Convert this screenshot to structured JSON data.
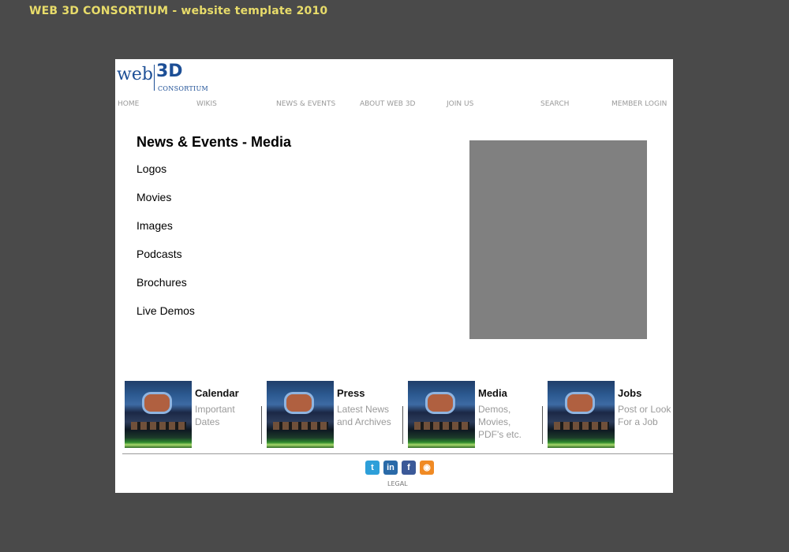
{
  "page_header": "WEB 3D CONSORTIUM - website template 2010",
  "logo": {
    "web": "web",
    "three_d": "3D",
    "consortium": "CONSORTIUM"
  },
  "nav": [
    {
      "label": "HOME"
    },
    {
      "label": "WIKIS"
    },
    {
      "label": "NEWS & EVENTS"
    },
    {
      "label": "ABOUT WEB 3D"
    },
    {
      "label": "JOIN US"
    },
    {
      "label": "SEARCH"
    },
    {
      "label": "MEMBER LOGIN"
    }
  ],
  "main": {
    "title": "News & Events - Media",
    "media_links": [
      "Logos",
      "Movies",
      "Images",
      "Podcasts",
      "Brochures",
      "Live Demos"
    ]
  },
  "features": [
    {
      "title": "Calendar",
      "desc": "Important Dates"
    },
    {
      "title": "Press",
      "desc": "Latest News and Archives"
    },
    {
      "title": "Media",
      "desc": "Demos, Movies, PDF's etc."
    },
    {
      "title": "Jobs",
      "desc": "Post or Look For a Job"
    }
  ],
  "social_icons": [
    {
      "name": "twitter-icon",
      "glyph": "t",
      "color": "#2d9fd9"
    },
    {
      "name": "linkedin-icon",
      "glyph": "in",
      "color": "#2a6aa8"
    },
    {
      "name": "facebook-icon",
      "glyph": "f",
      "color": "#3b5998"
    },
    {
      "name": "rss-icon",
      "glyph": "◉",
      "color": "#f08a24"
    }
  ],
  "footer": {
    "legal": "LEGAL"
  },
  "colors": {
    "page_bg": "#4a4a4a",
    "header_text": "#e8dc6a",
    "logo_blue": "#1d4f96",
    "nav_text": "#999999",
    "placeholder_box": "#808080"
  }
}
